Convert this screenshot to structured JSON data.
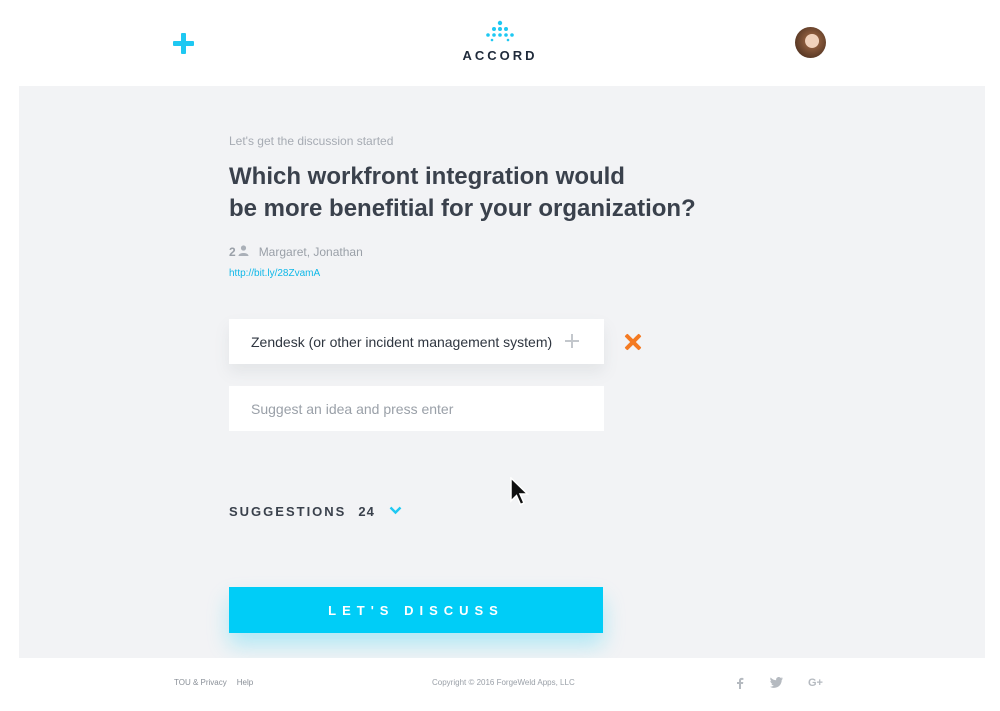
{
  "header": {
    "brand": "ACCORD",
    "brand_color": "#1ec8f2"
  },
  "discussion": {
    "intro": "Let's get the discussion started",
    "question_line1": "Which workfront integration would",
    "question_line2": "be more benefitial for your organization?",
    "participant_count": "2",
    "participants": "Margaret, Jonathan",
    "share_link": "http://bit.ly/28ZvamA"
  },
  "ideas": [
    {
      "text": "Zendesk (or other incident management system)"
    }
  ],
  "suggest_input": {
    "placeholder": "Suggest an idea and press enter",
    "value": ""
  },
  "suggestions": {
    "label": "SUGGESTIONS",
    "count": "24"
  },
  "cta": {
    "label": "LET'S DISCUSS",
    "color": "#00cdf7"
  },
  "footer": {
    "links": [
      "TOU & Privacy",
      "Help"
    ],
    "copyright": "Copyright © 2016 ForgeWeld Apps, LLC",
    "social": [
      "facebook-icon",
      "twitter-icon",
      "google-plus-icon"
    ]
  },
  "colors": {
    "accent": "#1ec8f2",
    "remove": "#f47a22",
    "panel_bg": "#f2f3f5"
  }
}
